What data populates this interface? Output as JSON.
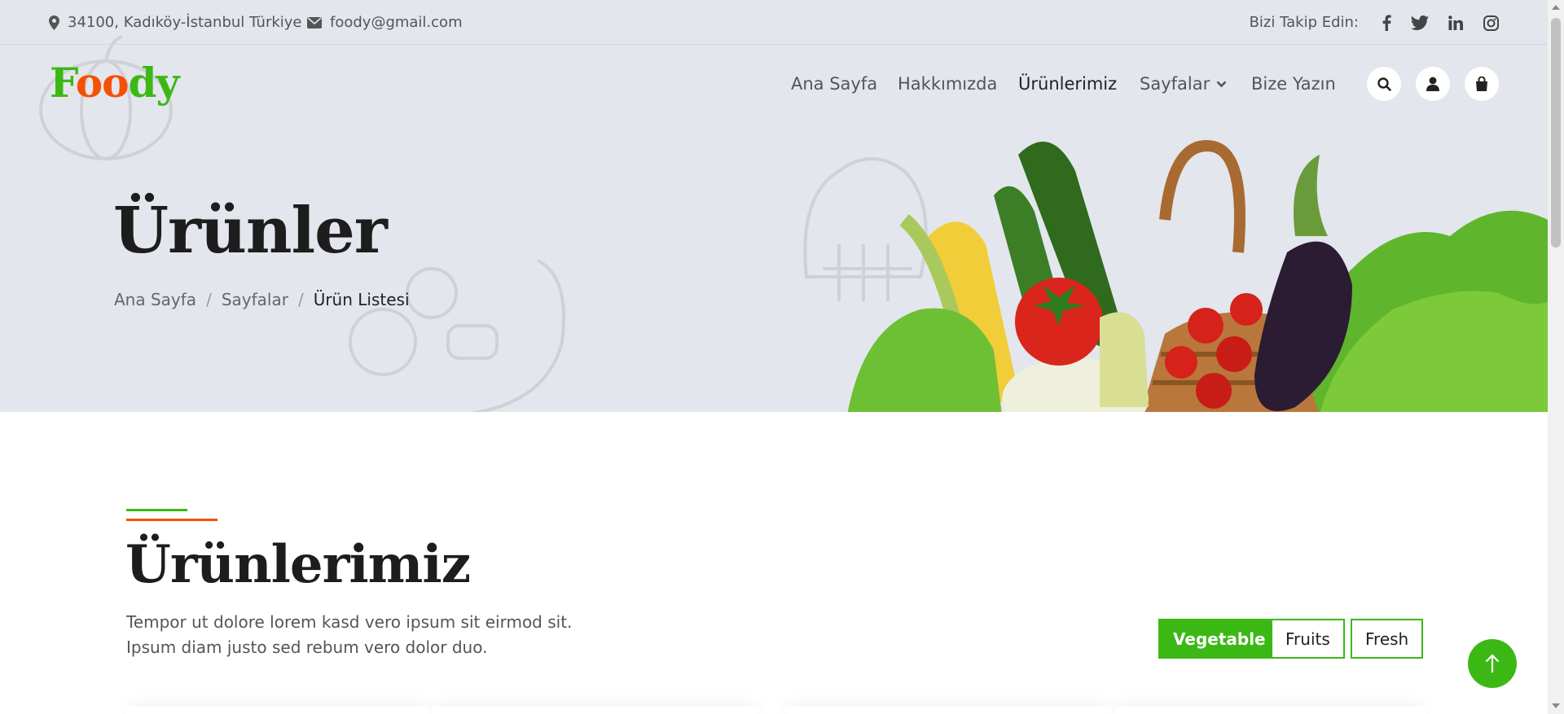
{
  "topbar": {
    "address": "34100, Kadıköy-İstanbul Türkiye",
    "email": "foody@gmail.com",
    "follow_label": "Bizi Takip Edin:",
    "socials": [
      "facebook-icon",
      "twitter-icon",
      "linkedin-icon",
      "instagram-icon"
    ]
  },
  "brand": {
    "logo_letters": [
      "F",
      "o",
      "o",
      "d",
      "y"
    ]
  },
  "nav": {
    "items": [
      {
        "label": "Ana Sayfa"
      },
      {
        "label": "Hakkımızda"
      },
      {
        "label": "Ürünlerimiz"
      },
      {
        "label": "Sayfalar"
      },
      {
        "label": "Bize Yazın"
      }
    ],
    "active": "Ürünlerimiz",
    "action_icons": [
      "search-icon",
      "user-icon",
      "shopping-bag-icon"
    ]
  },
  "hero": {
    "title": "Ürünler",
    "breadcrumb": [
      "Ana Sayfa",
      "Sayfalar",
      "Ürün Listesi"
    ]
  },
  "products": {
    "title": "Ürünlerimiz",
    "description": "Tempor ut dolore lorem kasd vero ipsum sit eirmod sit. Ipsum diam justo sed rebum vero dolor duo.",
    "filters": [
      {
        "label": "Vegetable",
        "active": true
      },
      {
        "label": "Fruits",
        "active": false
      },
      {
        "label": "Fresh",
        "active": false
      }
    ]
  },
  "colors": {
    "primary": "#3cb815",
    "secondary": "#f65005",
    "hero_bg": "#e3e6ec",
    "dark": "#1d1d1d"
  }
}
